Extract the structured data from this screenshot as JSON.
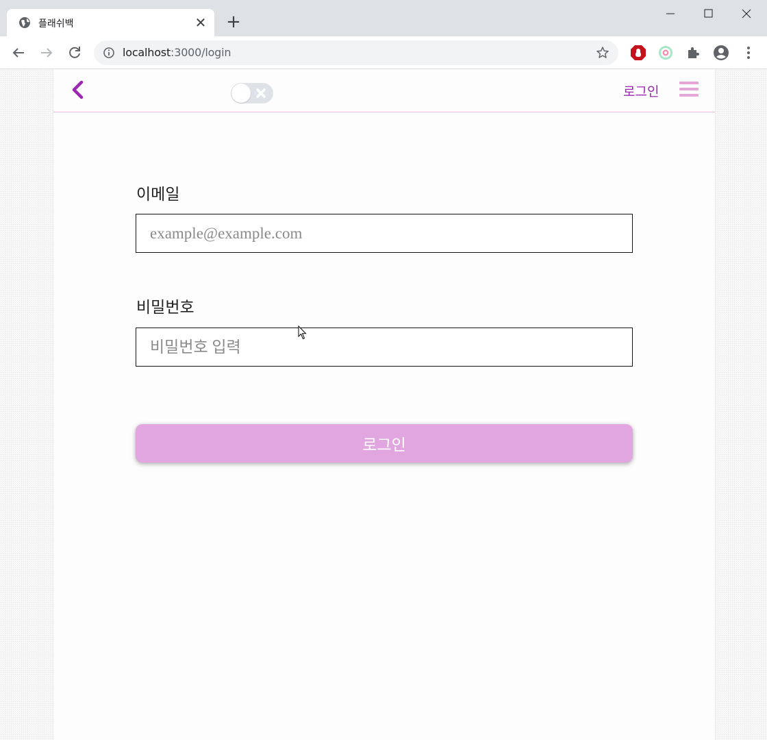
{
  "browser": {
    "tab_title": "플래쉬백",
    "new_tab": "+",
    "url_host": "localhost",
    "url_path": ":3000/login"
  },
  "header": {
    "login_link": "로그인",
    "dark_mode_toggle": "off"
  },
  "form": {
    "email_label": "이메일",
    "email_placeholder": "example@example.com",
    "email_value": "",
    "password_label": "비밀번호",
    "password_placeholder": "비밀번호 입력",
    "password_value": "",
    "submit_label": "로그인"
  },
  "colors": {
    "accent": "#9c27b0",
    "button_bg": "#e1a5e0",
    "hamburger": "#e3a6d6",
    "header_border": "#e6bcd8"
  },
  "icons": {
    "back": "chevron-left-icon",
    "menu": "hamburger-icon",
    "toggle_off": "close-icon"
  }
}
